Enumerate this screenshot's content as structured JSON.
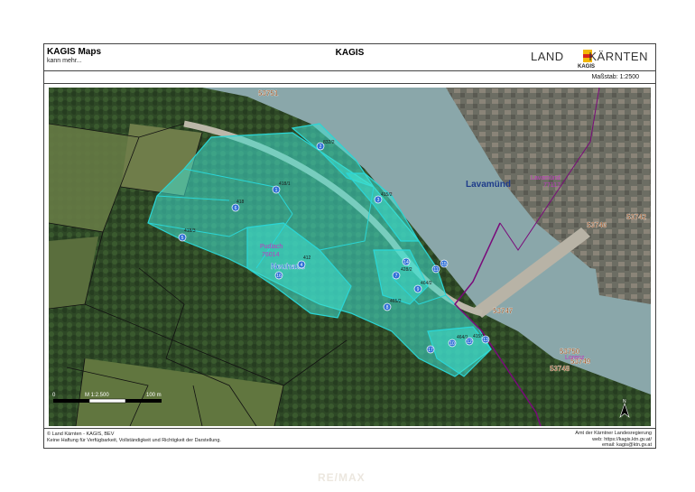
{
  "header": {
    "app_title": "KAGIS Maps",
    "app_subtitle": "kann mehr...",
    "center_title": "KAGIS",
    "logo_left": "LAND",
    "logo_right": "KÄRNTEN",
    "logo_sub": "KAGIS"
  },
  "scale": {
    "text": "Maßstab: 1:2500",
    "bar_zero": "0",
    "bar_label": "M 1:2.500",
    "bar_end": "100 m"
  },
  "map": {
    "town_label": "Lavamünd",
    "place_label_1": "Neuhaus",
    "place_label_2": "Pudlach",
    "place_label_3": "76014",
    "place_label_4": "Lavamünd",
    "place_label_5": "77117",
    "place_label_6": "Lorenz",
    "parcels": [
      "53751",
      "53746",
      "53742",
      "53747",
      "53750",
      "53749",
      "53748",
      "53749"
    ],
    "small_parcels": [
      "832/2",
      "418/1",
      "418",
      "418/3",
      "412",
      "415/2",
      "428/2",
      "464/2",
      "477",
      "465/2",
      "464/1",
      "415/1",
      "428/2",
      "477/2"
    ],
    "markers": [
      "2",
      "1",
      "3",
      "6",
      "5",
      "4",
      "7",
      "9",
      "11",
      "8",
      "10",
      "12",
      "13",
      "14",
      "15",
      "16",
      "17"
    ],
    "north_arrow": "N"
  },
  "footer": {
    "left_line1": "© Land Kärnten - KAGIS, BEV",
    "left_line2": "Keine Haftung für Verfügbarkeit, Vollständigkeit und Richtigkeit der Darstellung.",
    "right_line1": "Amt der Kärntner Landesregierung",
    "right_line2": "web: https://kagis.ktn.gv.at/",
    "right_line3": "email: kagis@ktn.gv.at"
  },
  "watermark": "RE/MAX",
  "colors": {
    "parcel_fill": "#3fe0d0",
    "parcel_stroke": "#2ad6d6",
    "parcel_number": "#8b4513",
    "boundary": "#7a0a7a",
    "river": "#8aa9ad",
    "forest": "#2f4a26",
    "marker": "#2f6fd6"
  }
}
